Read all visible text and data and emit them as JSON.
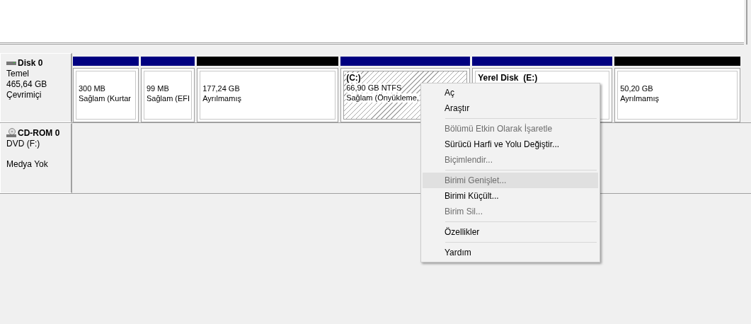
{
  "disks": [
    {
      "name": "Disk 0",
      "kind": "disk",
      "lines": [
        "Temel",
        "465,64 GB",
        "Çevrimiçi"
      ],
      "partitions": [
        {
          "kind": "primary",
          "selected": false,
          "lines": [
            "300 MB",
            "Sağlam (Kurtar"
          ]
        },
        {
          "kind": "primary",
          "selected": false,
          "lines": [
            "99 MB",
            "Sağlam (EFI"
          ]
        },
        {
          "kind": "unallocated",
          "selected": false,
          "lines": [
            "177,24 GB",
            "Ayrılmamış"
          ]
        },
        {
          "kind": "primary",
          "selected": true,
          "title": "(C:)",
          "lines": [
            "66,90 GB NTFS",
            "Sağlam (Önyükleme,"
          ]
        },
        {
          "kind": "primary",
          "selected": false,
          "title": "Yerel Disk  (E:)"
        },
        {
          "kind": "unallocated",
          "selected": false,
          "lines": [
            "50,20 GB",
            "Ayrılmamış"
          ]
        }
      ]
    },
    {
      "name": "CD-ROM 0",
      "kind": "cdrom",
      "lines": [
        "DVD (F:)"
      ],
      "status": "Medya Yok"
    }
  ],
  "context_menu": [
    {
      "kind": "item",
      "label": "Aç",
      "disabled": false,
      "selected": false
    },
    {
      "kind": "item",
      "label": "Araştır",
      "disabled": false,
      "selected": false
    },
    {
      "kind": "separator"
    },
    {
      "kind": "item",
      "label": "Bölümü Etkin Olarak İşaretle",
      "disabled": true,
      "selected": false
    },
    {
      "kind": "item",
      "label": "Sürücü Harfi ve Yolu Değiştir...",
      "disabled": false,
      "selected": false
    },
    {
      "kind": "item",
      "label": "Biçimlendir...",
      "disabled": true,
      "selected": false
    },
    {
      "kind": "separator"
    },
    {
      "kind": "item",
      "label": "Birimi Genişlet...",
      "disabled": true,
      "selected": true
    },
    {
      "kind": "item",
      "label": "Birimi Küçült...",
      "disabled": false,
      "selected": false
    },
    {
      "kind": "item",
      "label": "Birim Sil...",
      "disabled": true,
      "selected": false
    },
    {
      "kind": "separator"
    },
    {
      "kind": "item",
      "label": "Özellikler",
      "disabled": false,
      "selected": false
    },
    {
      "kind": "separator"
    },
    {
      "kind": "item",
      "label": "Yardım",
      "disabled": false,
      "selected": false
    }
  ]
}
